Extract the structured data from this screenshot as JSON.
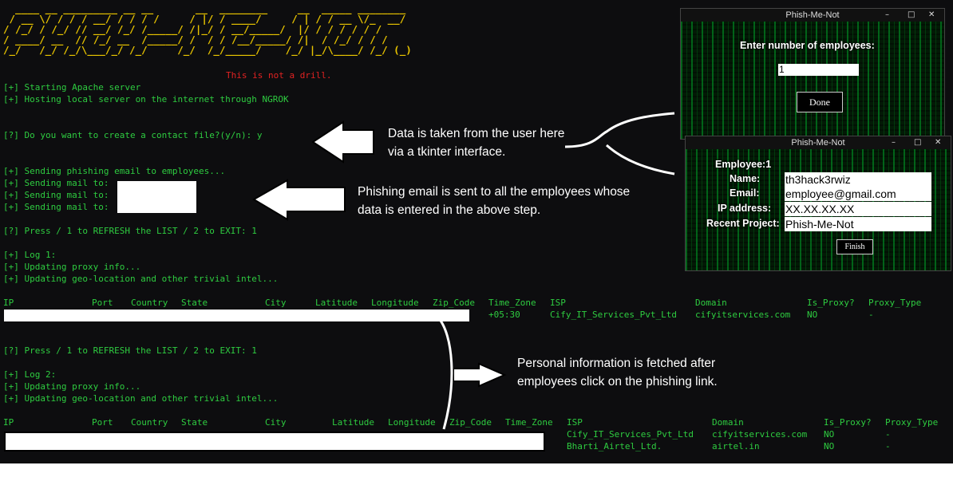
{
  "ascii_banner": [
    "  ____ __ _________ __ __       __  ________     __  _____ ________",
    " / __ \\/ / / / __/ / / / /     / |/ / ____/     / | / / __ \\/_  __/",
    "/ /_/ / /_/ // __/ /_/ /_____/ /|_/ / __/_____/  |/ / / / / / /   ",
    "/ ____/ __  // /_/ __  /_____/ /  / / /__/_____/ /|  / /_/ / / /    ",
    "/_/   /_/ /_/\\___/_/ /_/     /_/  /_/_____/    /_/ |_/\\____/ /_/ (_)"
  ],
  "drill_text": "This is not a drill.",
  "terminal": {
    "line1": "[+] Starting Apache server",
    "line2": "[+] Hosting local server on the internet through NGROK",
    "contact_prompt": "[?] Do you want to create a contact file?(y/n): y",
    "sending1": "[+] Sending phishing email to employees...",
    "mail1": "[+] Sending mail to:",
    "mail2": "[+] Sending mail to:",
    "mail3": "[+] Sending mail to:",
    "press1": "[?] Press / 1 to REFRESH the LIST / 2 to EXIT: 1",
    "log1": "[+] Log 1:",
    "proxy1": "[+] Updating proxy info...",
    "geo1": "[+] Updating geo-location and other trivial intel...",
    "press2": "[?] Press / 1 to REFRESH the LIST / 2 to EXIT: 1",
    "log2": "[+] Log 2:",
    "proxy2": "[+] Updating proxy info...",
    "geo2": "[+] Updating geo-location and other trivial intel..."
  },
  "table1": {
    "headers": [
      "IP",
      "Port",
      "Country",
      "State",
      "City",
      "Latitude",
      "Longitude",
      "Zip_Code",
      "Time_Zone",
      "ISP",
      "Domain",
      "Is_Proxy?",
      "Proxy_Type"
    ],
    "row": {
      "time_zone": "+05:30",
      "isp": "Cify_IT_Services_Pvt_Ltd",
      "domain": "cifyitservices.com",
      "is_proxy": "NO",
      "proxy_type": "-"
    }
  },
  "table2": {
    "headers": [
      "IP",
      "Port",
      "Country",
      "State",
      "City",
      "Latitude",
      "Longitude",
      "Zip_Code",
      "Time_Zone",
      "ISP",
      "Domain",
      "Is_Proxy?",
      "Proxy_Type"
    ],
    "rows": [
      {
        "isp": "Cify_IT_Services_Pvt_Ltd",
        "domain": "cifyitservices.com",
        "is_proxy": "NO",
        "proxy_type": "-"
      },
      {
        "isp": "Bharti_Airtel_Ltd.",
        "domain": "airtel.in",
        "is_proxy": "NO",
        "proxy_type": "-"
      }
    ]
  },
  "annotations": {
    "tkinter": [
      "Data is taken from the user here",
      "via a tkinter interface."
    ],
    "phishing": [
      "Phishing email is sent to all the employees whose",
      "data is entered in the above step."
    ],
    "personal": [
      "Personal information is fetched after",
      "employees click on the phishing link."
    ]
  },
  "window1": {
    "title": "Phish-Me-Not",
    "prompt": "Enter number of employees:",
    "input_value": "1",
    "button": "Done"
  },
  "window2": {
    "title": "Phish-Me-Not",
    "employee_label": "Employee:1",
    "name_label": "Name:",
    "name_value": "th3hack3rwiz",
    "email_label": "Email:",
    "email_value": "employee@gmail.com",
    "ip_label": "IP address:",
    "ip_value": "XX.XX.XX.XX",
    "project_label": "Recent Project:",
    "project_value": "Phish-Me-Not",
    "button": "Finish"
  },
  "colors": {
    "terminal_bg": "#0d0d0f",
    "terminal_text": "#2ecc40",
    "banner": "#e8c400",
    "alert": "#e22222"
  }
}
